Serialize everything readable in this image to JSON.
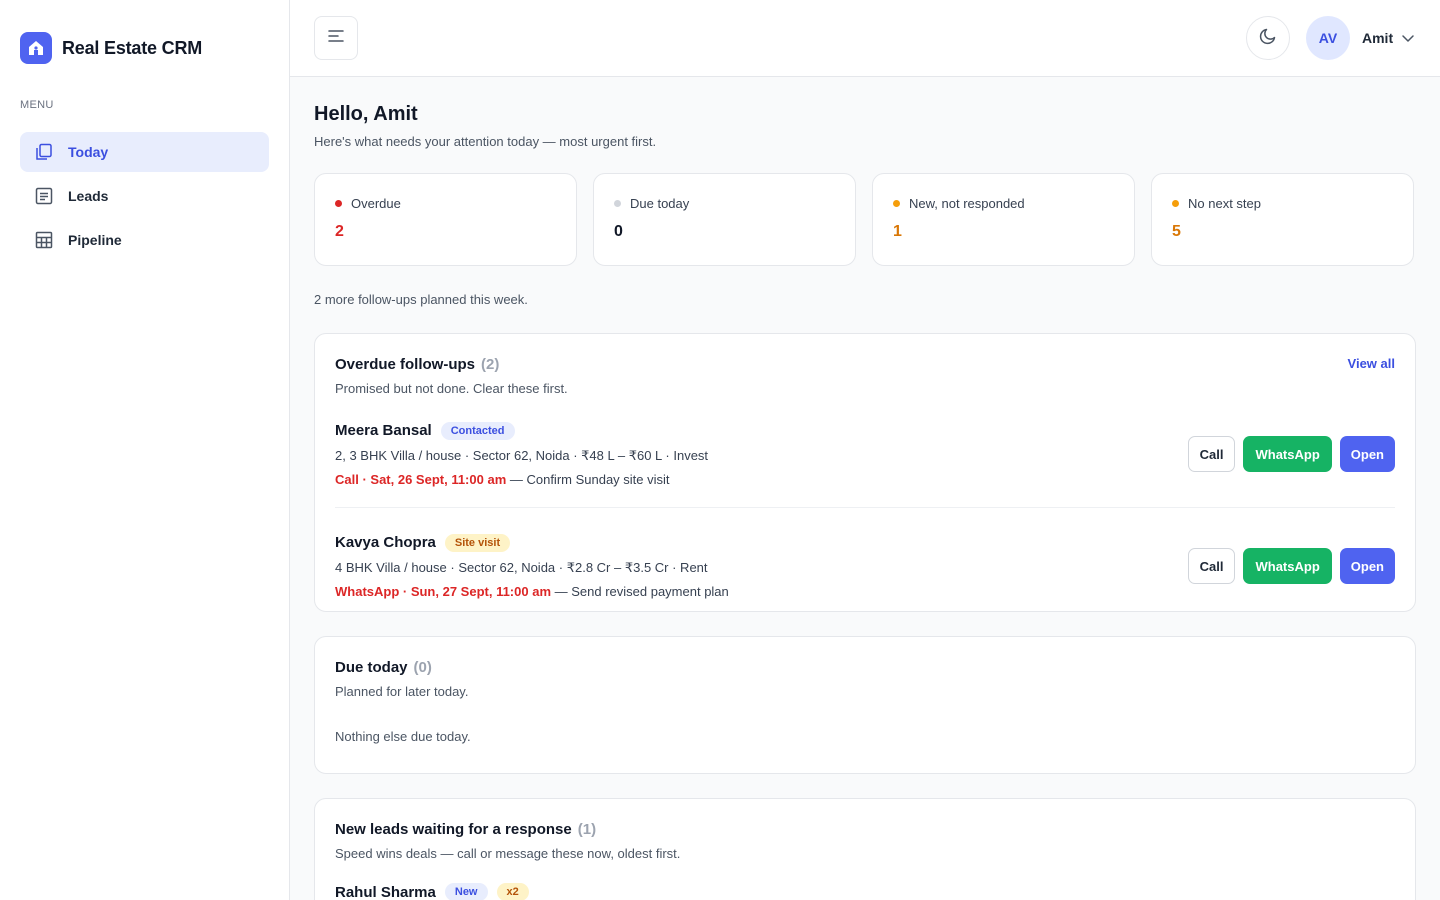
{
  "brand": {
    "name": "Real Estate CRM",
    "logo_icon": "home-icon",
    "accent": "#4f63f0"
  },
  "sidebar": {
    "menu_label": "MENU",
    "items": [
      {
        "label": "Today",
        "icon": "copy-icon",
        "active": true
      },
      {
        "label": "Leads",
        "icon": "list-icon",
        "active": false
      },
      {
        "label": "Pipeline",
        "icon": "grid-icon",
        "active": false
      }
    ]
  },
  "topbar": {
    "menu_icon": "menu-icon",
    "theme_icon": "moon-icon",
    "user": {
      "initials": "AV",
      "name": "Amit"
    }
  },
  "main": {
    "greeting": "Hello, Amit",
    "subtitle": "Here's what needs your attention today — most urgent first.",
    "stats": [
      {
        "label": "Overdue",
        "value": "2",
        "dot_color": "#dc2626",
        "value_color": "#dc2626"
      },
      {
        "label": "Due today",
        "value": "0",
        "dot_color": "#d1d5db",
        "value_color": "#111827"
      },
      {
        "label": "New, not responded",
        "value": "1",
        "dot_color": "#f59e0b",
        "value_color": "#d97706"
      },
      {
        "label": "No next step",
        "value": "5",
        "dot_color": "#f59e0b",
        "value_color": "#d97706"
      }
    ],
    "week_note": "2 more follow-ups planned this week."
  },
  "overdue": {
    "title": "Overdue follow-ups",
    "count": "(2)",
    "subtitle": "Promised but not done. Clear these first.",
    "view_all": "View all",
    "leads": [
      {
        "name": "Meera Bansal",
        "badge": "Contacted",
        "details": "2, 3 BHK Villa / house · Sector 62, Noida · ₹48 L – ₹60 L · Invest",
        "next_urgent": "Call · Sat, 26 Sept, 11:00 am",
        "next_note": " — Confirm Sunday site visit",
        "actions": {
          "call": "Call",
          "whatsapp": "WhatsApp",
          "open": "Open"
        }
      },
      {
        "name": "Kavya Chopra",
        "badge": "Site visit",
        "details": "4 BHK Villa / house · Sector 62, Noida · ₹2.8 Cr – ₹3.5 Cr · Rent",
        "next_urgent": "WhatsApp · Sun, 27 Sept, 11:00 am",
        "next_note": " — Send revised payment plan",
        "actions": {
          "call": "Call",
          "whatsapp": "WhatsApp",
          "open": "Open"
        }
      }
    ]
  },
  "due_today": {
    "title": "Due today",
    "count": "(0)",
    "subtitle": "Planned for later today.",
    "empty": "Nothing else due today."
  },
  "new_leads": {
    "title": "New leads waiting for a response",
    "count": "(1)",
    "subtitle": "Speed wins deals — call or message these now, oldest first.",
    "first_name": "Rahul Sharma",
    "first_badge": "New",
    "first_badge2": "x2"
  }
}
